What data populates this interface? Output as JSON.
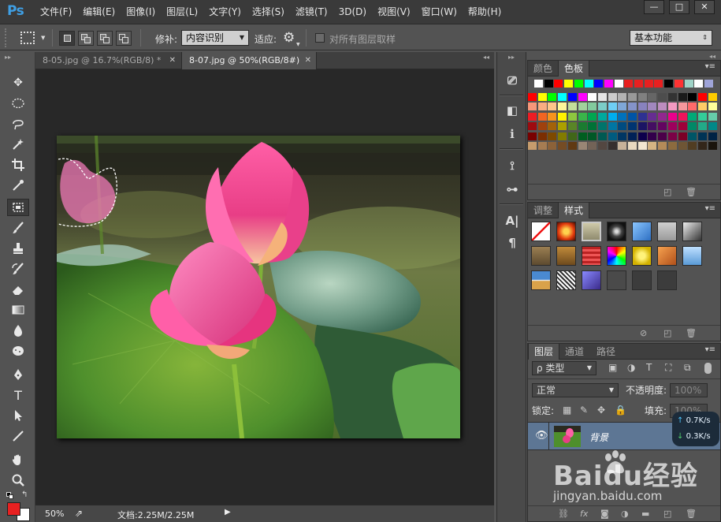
{
  "app": {
    "logo": "Ps"
  },
  "menu": [
    "文件(F)",
    "编辑(E)",
    "图像(I)",
    "图层(L)",
    "文字(Y)",
    "选择(S)",
    "滤镜(T)",
    "3D(D)",
    "视图(V)",
    "窗口(W)",
    "帮助(H)"
  ],
  "window_controls": {
    "minimize": "—",
    "restore": "□",
    "close": "✕"
  },
  "options_bar": {
    "patch_label": "修补:",
    "patch_value": "内容识别",
    "adapt_label": "适应:",
    "sample_all_label": "对所有图层取样",
    "sample_all_checked": false,
    "workspace": "基本功能"
  },
  "documents": {
    "tabs": [
      {
        "label": "8-05.jpg @ 16.7%(RGB/8) *",
        "active": false
      },
      {
        "label": "8-07.jpg @ 50%(RGB/8#)",
        "active": true
      }
    ],
    "close_glyph": "✕"
  },
  "status_bar": {
    "zoom": "50%",
    "doc_info": "文档:2.25M/2.25M"
  },
  "panels": {
    "color": {
      "tabs": [
        "颜色",
        "色板"
      ],
      "active_tab": 1
    },
    "styles": {
      "tabs": [
        "调整",
        "样式"
      ],
      "active_tab": 1
    },
    "layers": {
      "tabs": [
        "图层",
        "通道",
        "路径"
      ],
      "active_tab": 0,
      "filter_kind": "ρ 类型",
      "blend_mode": "正常",
      "opacity_label": "不透明度:",
      "opacity_value": "100%",
      "lock_label": "锁定:",
      "fill_label": "填充:",
      "fill_value": "100%",
      "layer_name": "背景"
    }
  },
  "net_speed": {
    "up": "0.7K/s",
    "down": "0.3K/s"
  },
  "watermark": {
    "brand": "Baidu经验",
    "url": "jingyan.baidu.com"
  },
  "colors": {
    "foreground": "#e82020",
    "background": "#ffffff",
    "swatches_top": [
      "#ffffff",
      "#000000",
      "#ff0000",
      "#ffff00",
      "#00ff00",
      "#00ffff",
      "#0000ff",
      "#ff00ff",
      "#ffffff",
      "#e82020",
      "#e82020",
      "#e82020",
      "#e82020",
      "#000000",
      "#ff3333",
      "#9fd3c7",
      "#ffffff",
      "#9fa4d9"
    ]
  }
}
